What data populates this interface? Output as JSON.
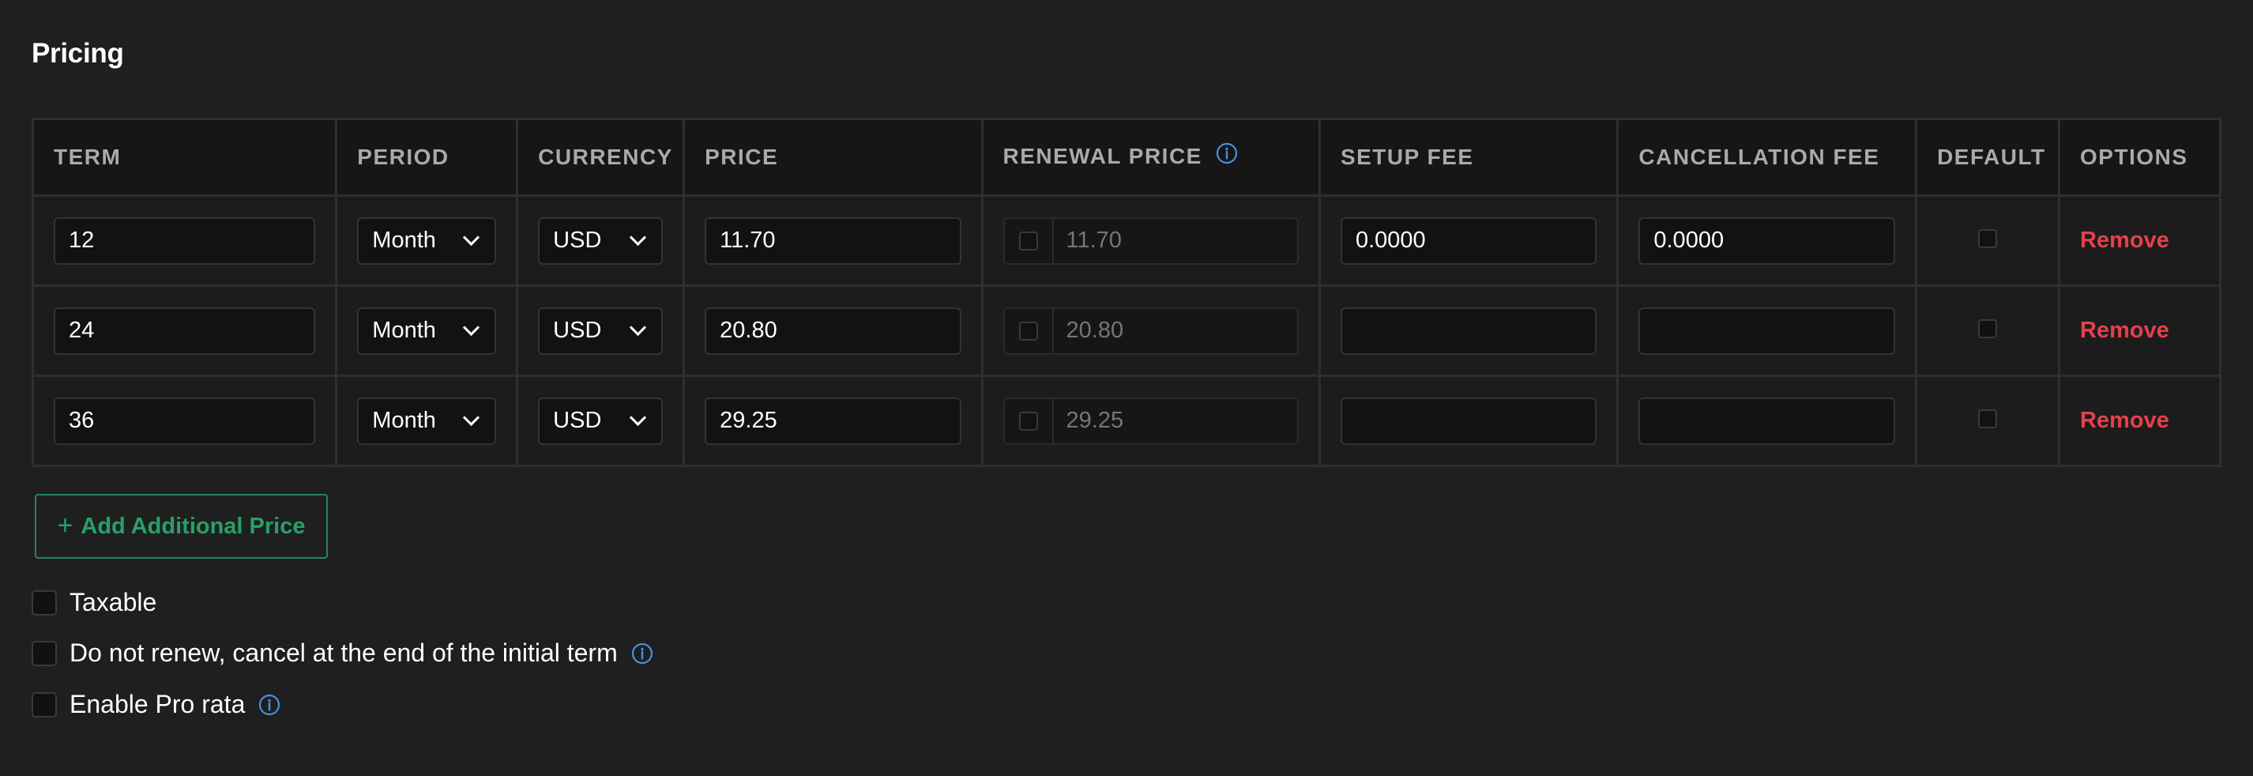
{
  "section": {
    "title": "Pricing"
  },
  "table": {
    "headers": {
      "term": "TERM",
      "period": "PERIOD",
      "currency": "CURRENCY",
      "price": "PRICE",
      "renewal_price": "RENEWAL PRICE",
      "setup_fee": "SETUP FEE",
      "cancellation_fee": "CANCELLATION FEE",
      "default": "DEFAULT",
      "options": "OPTIONS"
    },
    "rows": [
      {
        "term": "12",
        "period": "Month",
        "currency": "USD",
        "price": "11.70",
        "renewal_price": "11.70",
        "renewal_override": false,
        "setup_fee": "0.0000",
        "cancellation_fee": "0.0000",
        "default": false,
        "remove_label": "Remove"
      },
      {
        "term": "24",
        "period": "Month",
        "currency": "USD",
        "price": "20.80",
        "renewal_price": "20.80",
        "renewal_override": false,
        "setup_fee": "",
        "cancellation_fee": "",
        "default": false,
        "remove_label": "Remove"
      },
      {
        "term": "36",
        "period": "Month",
        "currency": "USD",
        "price": "29.25",
        "renewal_price": "29.25",
        "renewal_override": false,
        "setup_fee": "",
        "cancellation_fee": "",
        "default": false,
        "remove_label": "Remove"
      }
    ]
  },
  "add_button": {
    "label": "Add Additional Price",
    "icon": "plus-icon"
  },
  "options": [
    {
      "label": "Taxable",
      "checked": false,
      "has_info": false
    },
    {
      "label": "Do not renew, cancel at the end of the initial term",
      "checked": false,
      "has_info": true
    },
    {
      "label": "Enable Pro rata",
      "checked": false,
      "has_info": true
    }
  ],
  "colors": {
    "background": "#1f1f1f",
    "header_bg": "#161616",
    "accent_green": "#27a06a",
    "danger_red": "#e5404d",
    "info_blue": "#4a8fe0"
  }
}
